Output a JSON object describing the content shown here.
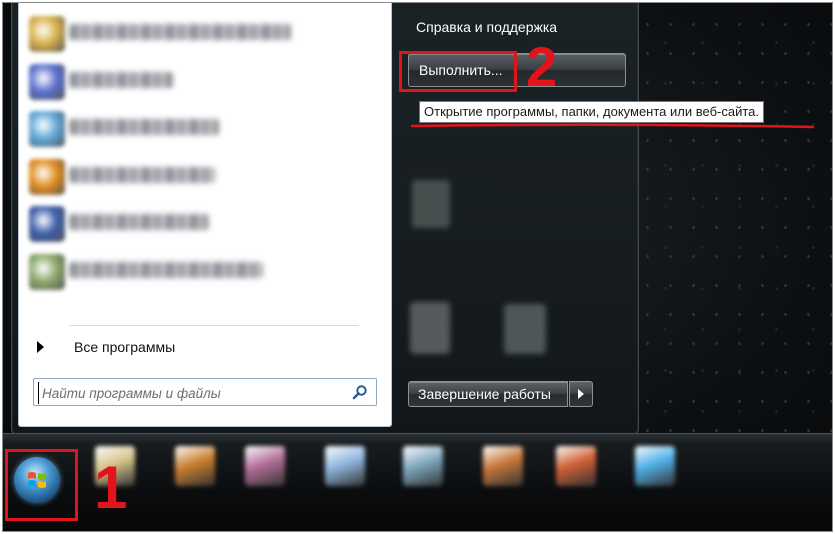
{
  "start_menu": {
    "left_pane": {
      "programs": [
        {
          "icon": "program-icon-1",
          "color": "#d8b04a"
        },
        {
          "icon": "program-icon-2",
          "color": "#5a6fcf"
        },
        {
          "icon": "program-icon-3",
          "color": "#5fa8d8"
        },
        {
          "icon": "program-icon-4",
          "color": "#e08c1e"
        },
        {
          "icon": "program-icon-5",
          "color": "#3c5da8"
        },
        {
          "icon": "program-icon-6",
          "color": "#8aa86a"
        }
      ],
      "all_programs_label": "Все программы",
      "search_placeholder": "Найти программы и файлы"
    },
    "right_pane": {
      "help_label": "Справка и поддержка",
      "run_label": "Выполнить...",
      "shutdown_label": "Завершение работы"
    },
    "tooltip": "Открытие программы, папки, документа или веб-сайта."
  },
  "annotations": {
    "step_1": "1",
    "step_2": "2",
    "highlight_color": "#e1141b"
  },
  "taskbar": {
    "pinned_icons": [
      {
        "icon": "taskbar-icon-1",
        "color": "#d7c48a"
      },
      {
        "icon": "taskbar-icon-2",
        "color": "#c9802e"
      },
      {
        "icon": "taskbar-icon-3",
        "color": "#b46f9a"
      },
      {
        "icon": "taskbar-icon-4",
        "color": "#8fb7e0"
      },
      {
        "icon": "taskbar-icon-5",
        "color": "#7fa9c0"
      },
      {
        "icon": "taskbar-icon-6",
        "color": "#c8773a"
      },
      {
        "icon": "taskbar-icon-7",
        "color": "#d06034"
      },
      {
        "icon": "taskbar-icon-8",
        "color": "#4fb0e8"
      }
    ]
  }
}
